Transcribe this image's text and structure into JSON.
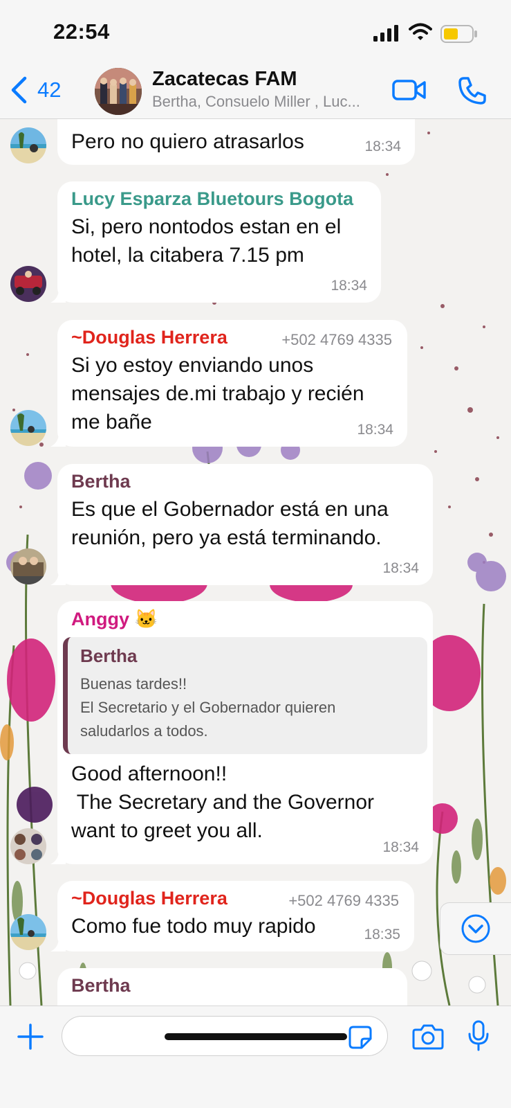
{
  "status_bar": {
    "time": "22:54"
  },
  "header": {
    "back_count": "42",
    "group_name": "Zacatecas FAM",
    "members": "Bertha, Consuelo Miller , Luc..."
  },
  "messages": [
    {
      "text": "Pero no quiero atrasarlos",
      "time": "18:34"
    },
    {
      "sender": "Lucy Esparza  Bluetours Bogota",
      "text_lines": [
        "Si, pero nontodos estan en el",
        "hotel, la citabera 7.15 pm"
      ],
      "time": "18:34"
    },
    {
      "sender": "~Douglas Herrera",
      "phone": "+502 4769 4335",
      "text_lines": [
        "Si yo estoy enviando unos",
        "mensajes de.mi trabajo y recién",
        "me bañe"
      ],
      "time": "18:34"
    },
    {
      "sender": "Bertha",
      "text_lines": [
        "Es que el Gobernador está en una",
        "reunión, pero ya está terminando."
      ],
      "time": "18:34"
    },
    {
      "sender": "Anggy 🐱",
      "reply": {
        "sender": "Bertha",
        "lines": [
          "Buenas tardes!!",
          "El Secretario y el Gobernador quieren",
          "saludarlos a todos."
        ]
      },
      "text_lines": [
        "Good afternoon!!",
        " The Secretary and the Governor",
        "want to greet you all."
      ],
      "time": "18:34"
    },
    {
      "sender": "~Douglas Herrera",
      "phone": "+502 4769 4335",
      "text": "Como fue todo muy rapido",
      "time": "18:35"
    },
    {
      "sender": "Bertha"
    }
  ],
  "colors": {
    "accent": "#0a7bff",
    "lucy": "#3a9a8a",
    "douglas": "#e0241c",
    "bertha": "#6e3a4f",
    "anggy": "#d01a7f"
  },
  "icons": [
    "back-chevron-icon",
    "video-camera-icon",
    "phone-icon",
    "plus-icon",
    "sticker-icon",
    "camera-icon",
    "microphone-icon",
    "chevron-down-icon"
  ],
  "composer": {
    "placeholder": ""
  }
}
